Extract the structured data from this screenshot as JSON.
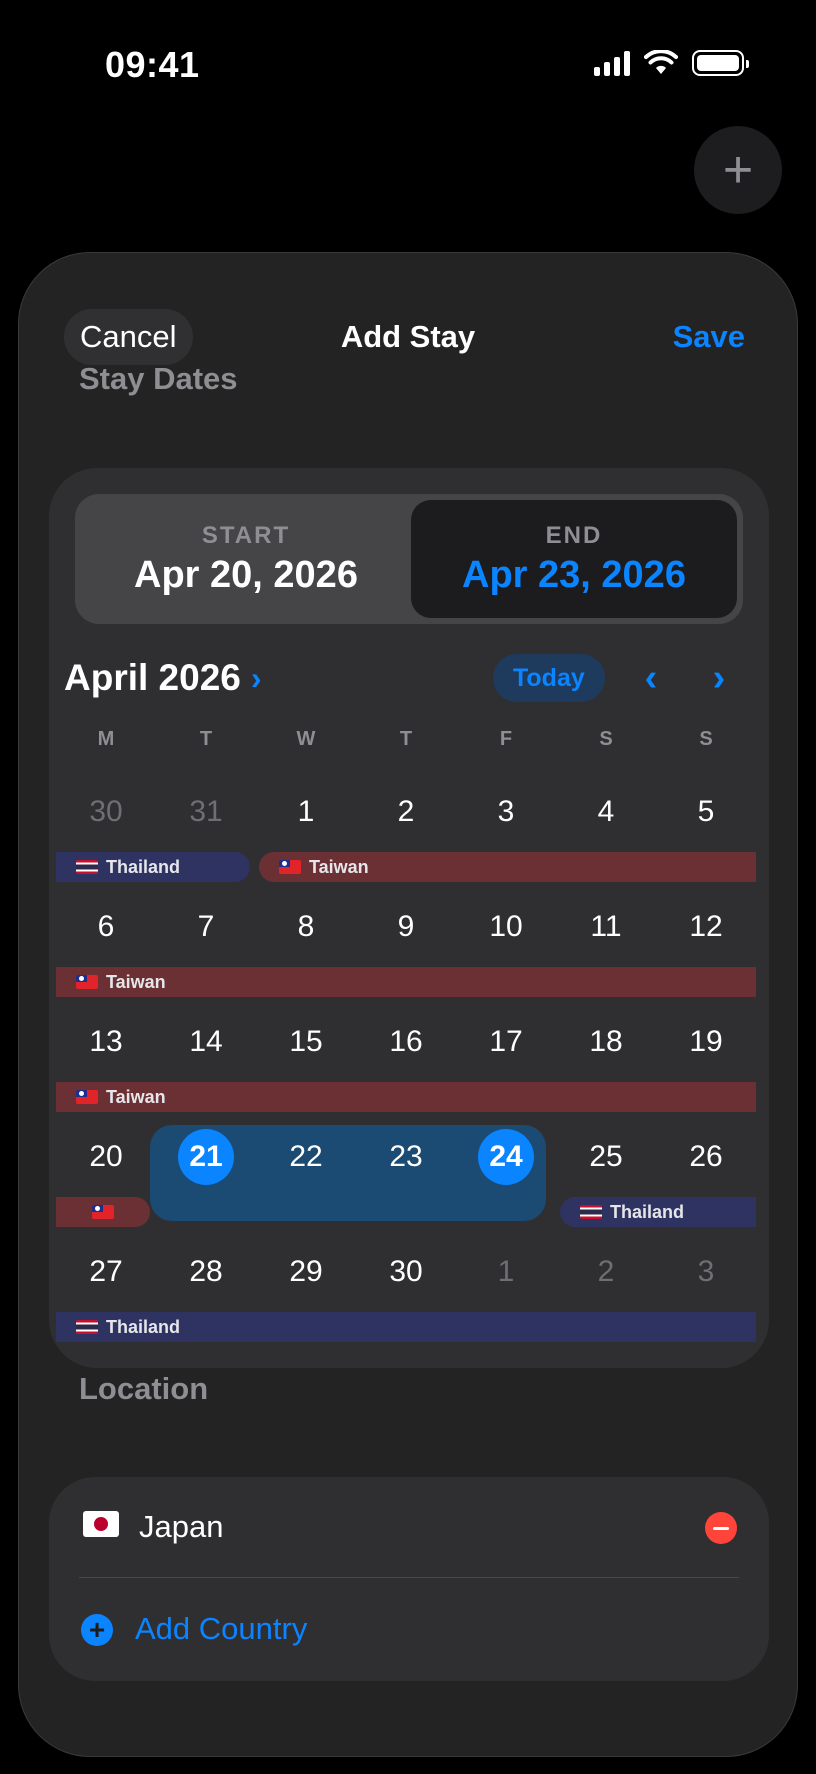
{
  "status_bar": {
    "time": "09:41"
  },
  "background": {
    "plus_label": "+"
  },
  "sheet": {
    "cancel_label": "Cancel",
    "title": "Add Stay",
    "save_label": "Save"
  },
  "stay_dates": {
    "header": "Stay Dates",
    "start_label": "START",
    "start_value": "Apr 20, 2026",
    "end_label": "END",
    "end_value": "Apr 23, 2026"
  },
  "calendar": {
    "month_title": "April 2026",
    "month_chevron": "›",
    "today_label": "Today",
    "prev_icon": "‹",
    "next_icon": "›",
    "weekdays": [
      "M",
      "T",
      "W",
      "T",
      "F",
      "S",
      "S"
    ],
    "weeks": [
      [
        "30",
        "31",
        "1",
        "2",
        "3",
        "4",
        "5"
      ],
      [
        "6",
        "7",
        "8",
        "9",
        "10",
        "11",
        "12"
      ],
      [
        "13",
        "14",
        "15",
        "16",
        "17",
        "18",
        "19"
      ],
      [
        "20",
        "21",
        "22",
        "23",
        "24",
        "25",
        "26"
      ],
      [
        "27",
        "28",
        "29",
        "30",
        "1",
        "2",
        "3"
      ]
    ],
    "stays": {
      "thailand": "Thailand",
      "taiwan": "Taiwan"
    },
    "selected_days": [
      "21",
      "24"
    ],
    "colors": {
      "accent": "#0a84ff",
      "thailand_bar": "#2e3362",
      "taiwan_bar": "#6b3034",
      "range": "#1b4a72"
    }
  },
  "location": {
    "header": "Location",
    "country": "Japan",
    "add_label": "Add Country",
    "add_icon": "+"
  }
}
